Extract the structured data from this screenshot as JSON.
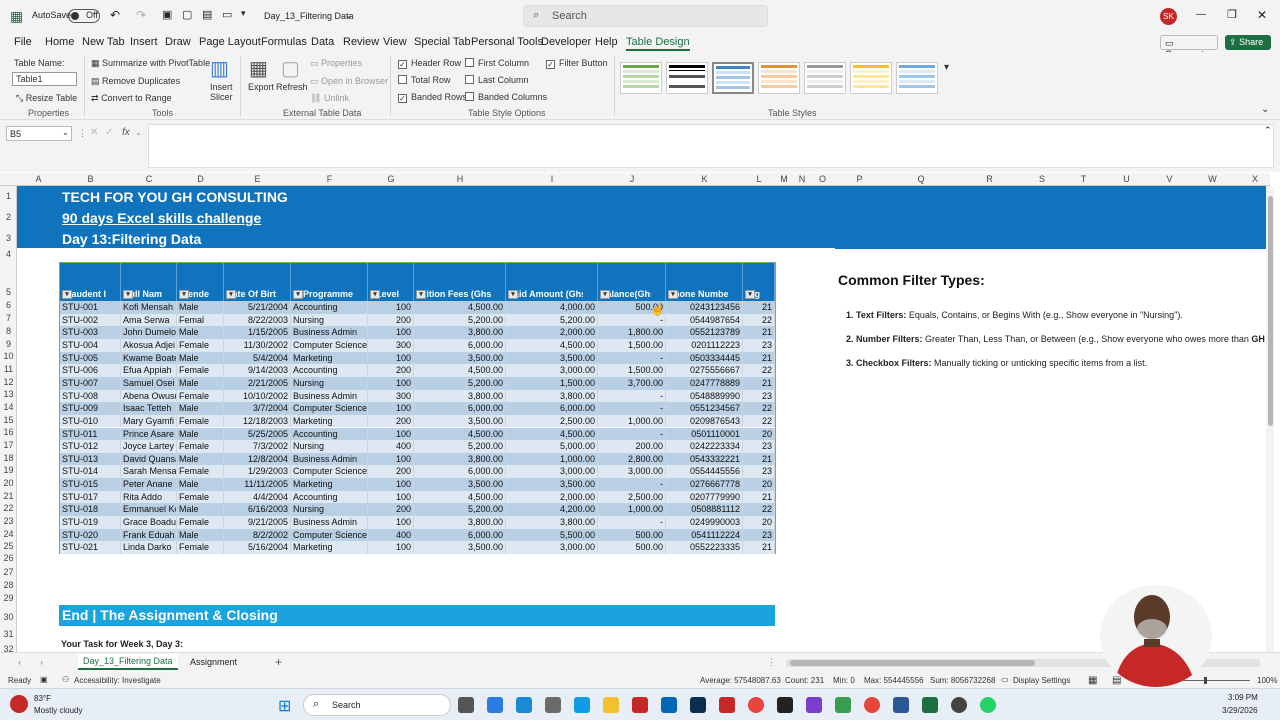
{
  "titlebar": {
    "autosave": "AutoSave",
    "toggle": "Off",
    "filename": "Day_13_Filtering Data",
    "search": "Search",
    "user_initials": "SK"
  },
  "menu": [
    "File",
    "Home",
    "New Tab",
    "Insert",
    "Draw",
    "Page Layout",
    "Formulas",
    "Data",
    "Review",
    "View",
    "Special Tab",
    "Personal Tools",
    "Developer",
    "Help",
    "Table Design"
  ],
  "menu_right": {
    "comments": "Comments",
    "share": "Share"
  },
  "ribbon": {
    "table_name_label": "Table Name:",
    "table_name_value": "Table1",
    "resize": "Resize Table",
    "properties_group": "Properties",
    "summarize": "Summarize with PivotTable",
    "remove_dup": "Remove Duplicates",
    "convert": "Convert to Range",
    "tools_group": "Tools",
    "insert_slicer": "Insert Slicer",
    "export": "Export",
    "refresh": "Refresh",
    "props": "Properties",
    "open_browser": "Open in Browser",
    "unlink": "Unlink",
    "external_group": "External Table Data",
    "header_row": "Header Row",
    "total_row": "Total Row",
    "banded_rows": "Banded Rows",
    "first_column": "First Column",
    "last_column": "Last Column",
    "banded_columns": "Banded Columns",
    "filter_button": "Filter Button",
    "style_options_group": "Table Style Options",
    "styles_group": "Table Styles"
  },
  "formula": {
    "namebox": "B5",
    "fx": "fx"
  },
  "columns": [
    "A",
    "B",
    "C",
    "D",
    "E",
    "F",
    "G",
    "H",
    "I",
    "J",
    "K",
    "L",
    "M",
    "N",
    "O",
    "P",
    "Q",
    "R",
    "S",
    "T",
    "U",
    "V",
    "W",
    "X"
  ],
  "rows": [
    "1",
    "2",
    "3",
    "4",
    "5",
    "6",
    "7",
    "8",
    "9",
    "10",
    "11",
    "12",
    "13",
    "14",
    "15",
    "16",
    "17",
    "18",
    "19",
    "20",
    "21",
    "22",
    "23",
    "24",
    "25",
    "26",
    "27",
    "28",
    "29",
    "30",
    "31",
    "32"
  ],
  "banner": {
    "line1": "TECH FOR YOU  GH CONSULTING",
    "line2": "90 days Excel skills challenge",
    "line3": "Day 13:Filtering Data"
  },
  "table": {
    "headers": [
      "Staudent I",
      "Full Nam",
      "Gende",
      "Date Of Birt",
      "Programme",
      "Level",
      "Tuition Fees (Ghs",
      "Paid Amount (Ghs",
      "Balance(Ghs",
      "Phone Numbe",
      "Ag"
    ],
    "rows": [
      [
        "STU-001",
        "Kofi Mensah",
        "Male",
        "5/21/2004",
        "Accounting",
        "100",
        "4,500.00",
        "4,000.00",
        "500.00",
        "0243123456",
        "21"
      ],
      [
        "STU-002",
        "Ama Serwa",
        "Femal",
        "8/22/2003",
        "Nursing",
        "200",
        "5,200.00",
        "5,200.00",
        "-",
        "0544987654",
        "22"
      ],
      [
        "STU-003",
        "John Dumelo",
        "Male",
        "1/15/2005",
        "Business Admin",
        "100",
        "3,800.00",
        "2,000.00",
        "1,800.00",
        "0552123789",
        "21"
      ],
      [
        "STU-004",
        "Akosua Adjei",
        "Female",
        "11/30/2002",
        "Computer Science",
        "300",
        "6,000.00",
        "4,500.00",
        "1,500.00",
        "0201112223",
        "23"
      ],
      [
        "STU-005",
        "Kwame Boate",
        "Male",
        "5/4/2004",
        "Marketing",
        "100",
        "3,500.00",
        "3,500.00",
        "-",
        "0503334445",
        "21"
      ],
      [
        "STU-006",
        "Efua Appiah",
        "Female",
        "9/14/2003",
        "Accounting",
        "200",
        "4,500.00",
        "3,000.00",
        "1,500.00",
        "0275556667",
        "22"
      ],
      [
        "STU-007",
        "Samuel Osei",
        "Male",
        "2/21/2005",
        "Nursing",
        "100",
        "5,200.00",
        "1,500.00",
        "3,700.00",
        "0247778889",
        "21"
      ],
      [
        "STU-008",
        "Abena Owusu",
        "Female",
        "10/10/2002",
        "Business Admin",
        "300",
        "3,800.00",
        "3,800.00",
        "-",
        "0548889990",
        "23"
      ],
      [
        "STU-009",
        "Isaac Tetteh",
        "Male",
        "3/7/2004",
        "Computer Science",
        "100",
        "6,000.00",
        "6,000.00",
        "-",
        "0551234567",
        "22"
      ],
      [
        "STU-010",
        "Mary Gyamfi",
        "Female",
        "12/18/2003",
        "Marketing",
        "200",
        "3,500.00",
        "2,500.00",
        "1,000.00",
        "0209876543",
        "22"
      ],
      [
        "STU-011",
        "Prince Asare",
        "Male",
        "5/25/2005",
        "Accounting",
        "100",
        "4,500.00",
        "4,500.00",
        "-",
        "0501110001",
        "20"
      ],
      [
        "STU-012",
        "Joyce Lartey",
        "Female",
        "7/3/2002",
        "Nursing",
        "400",
        "5,200.00",
        "5,000.00",
        "200.00",
        "0242223334",
        "23"
      ],
      [
        "STU-013",
        "David Quansa",
        "Male",
        "12/8/2004",
        "Business Admin",
        "100",
        "3,800.00",
        "1,000.00",
        "2,800.00",
        "0543332221",
        "21"
      ],
      [
        "STU-014",
        "Sarah Mensah",
        "Female",
        "1/29/2003",
        "Computer Science",
        "200",
        "6,000.00",
        "3,000.00",
        "3,000.00",
        "0554445556",
        "23"
      ],
      [
        "STU-015",
        "Peter Anane",
        "Male",
        "11/11/2005",
        "Marketing",
        "100",
        "3,500.00",
        "3,500.00",
        "-",
        "0276667778",
        "20"
      ],
      [
        "STU-017",
        "Rita Addo",
        "Female",
        "4/4/2004",
        "Accounting",
        "100",
        "4,500.00",
        "2,000.00",
        "2,500.00",
        "0207779990",
        "21"
      ],
      [
        "STU-018",
        "Emmanuel Ko",
        "Male",
        "6/16/2003",
        "Nursing",
        "200",
        "5,200.00",
        "4,200.00",
        "1,000.00",
        "0508881112",
        "22"
      ],
      [
        "STU-019",
        "Grace Boadu",
        "Female",
        "9/21/2005",
        "Business Admin",
        "100",
        "3,800.00",
        "3,800.00",
        "-",
        "0249990003",
        "20"
      ],
      [
        "STU-020",
        "Frank Eduah",
        "Male",
        "8/2/2002",
        "Computer Science",
        "400",
        "6,000.00",
        "5,500.00",
        "500.00",
        "0541112224",
        "23"
      ],
      [
        "STU-021",
        "Linda Darko",
        "Female",
        "5/16/2004",
        "Marketing",
        "100",
        "3,500.00",
        "3,000.00",
        "500.00",
        "0552223335",
        "21"
      ]
    ]
  },
  "filters": {
    "title": "Common Filter Types:",
    "items": [
      {
        "label": "1. Text Filters:",
        "text": " Equals, Contains, or Begins With (e.g., Show everyone in \"Nursing\")."
      },
      {
        "label": "2. Number Filters:",
        "text": " Greater Than, Less Than, or Between (e.g., Show everyone who owes more than ",
        "tail": "GH"
      },
      {
        "label": "3. Checkbox Filters:",
        "text": " Manually ticking or unticking specific items from a list."
      }
    ]
  },
  "assignment": {
    "title": "End | The Assignment & Closing",
    "task": "Your Task for Week 3, Day 3:"
  },
  "sheets": [
    "Day_13_Filtering Data",
    "Assignment"
  ],
  "status": {
    "ready": "Ready",
    "accessibility": "Accessibility: Investigate",
    "average": "Average: 57548087.63",
    "count": "Count: 231",
    "min": "Min: 0",
    "max": "Max: 554445556",
    "sum": "Sum: 8056732268",
    "display": "Display Settings",
    "zoom": "100%"
  },
  "taskbar": {
    "temp": "83°F",
    "weather": "Mostly cloudy",
    "search": "Search",
    "time": "3:09 PM",
    "date": "3/29/2026"
  },
  "colors": {
    "accent": "#1d6f42",
    "table_header": "#0f74bd",
    "band_odd": "#b9cfe3",
    "band_even": "#dde8f2",
    "assign_bar": "#1aa3dd"
  }
}
